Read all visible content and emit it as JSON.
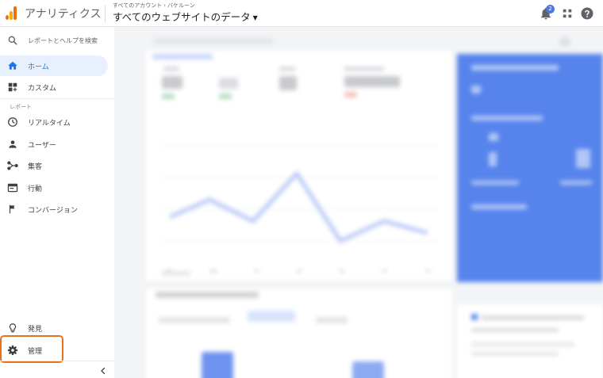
{
  "app": {
    "title": "アナリティクス",
    "breadcrumb": [
      "すべてのアカウント",
      "バケルーン"
    ],
    "breadcrumb_sep": "›",
    "property": "すべてのウェブサイトのデータ",
    "notifications_count": "2"
  },
  "sidebar": {
    "search_placeholder": "レポートとヘルプを検索",
    "home": "ホーム",
    "custom": "カスタム",
    "section_reports": "レポート",
    "items": [
      "リアルタイム",
      "ユーザー",
      "集客",
      "行動",
      "コンバージョン"
    ],
    "discover": "発見",
    "admin": "管理"
  },
  "colors": {
    "accent": "#1a73e8",
    "active_bg": "#e8f0fe",
    "highlight": "#e8711e",
    "logo_orange": "#e8710a",
    "logo_yellow": "#f9ab00",
    "blue_panel": "#5684ec"
  },
  "icons": {
    "search": "search-icon",
    "home": "home-icon",
    "custom": "dashboard-plus-icon",
    "realtime": "clock-icon",
    "users": "person-icon",
    "acquisition": "acquisition-icon",
    "behavior": "browser-window-icon",
    "conversions": "flag-icon",
    "discover": "lightbulb-icon",
    "admin": "gear-icon",
    "collapse": "chevron-left-icon",
    "notifications": "bell-icon",
    "apps": "apps-grid-icon",
    "help": "help-icon"
  }
}
